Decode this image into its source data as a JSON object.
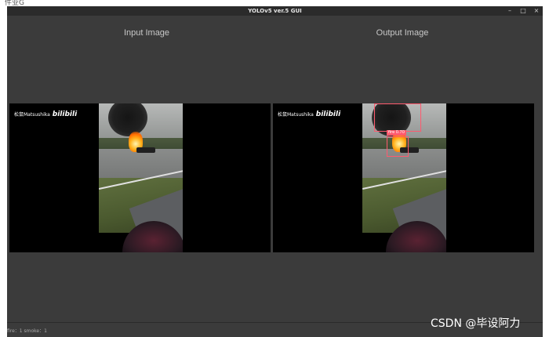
{
  "top_strip_text": "件业G",
  "window": {
    "title": "YOLOv5 ver.5 GUI",
    "controls": {
      "minimize": "–",
      "maximize": "□",
      "close": "×"
    }
  },
  "labels": {
    "input": "Input Image",
    "output": "Output Image"
  },
  "watermark": {
    "author": "松鼠Matsushika",
    "logo": "bilibili"
  },
  "detection_label": "fire 0.70",
  "status": "fire：1  smoke：1",
  "corner_watermark": "CSDN @毕设阿力"
}
